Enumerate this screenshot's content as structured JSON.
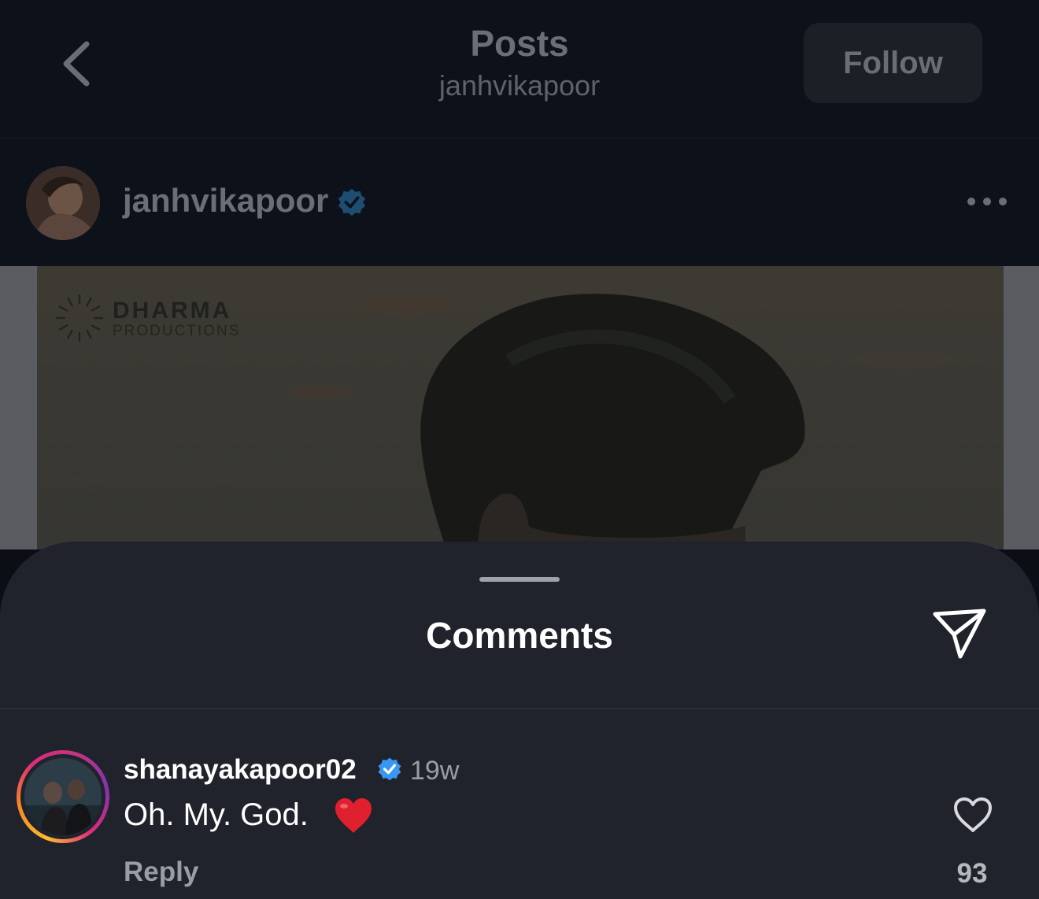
{
  "header": {
    "title": "Posts",
    "subtitle": "janhvikapoor",
    "follow_label": "Follow",
    "back_icon": "chevron-left-icon"
  },
  "post": {
    "username": "janhvikapoor",
    "verified": true,
    "more_icon": "more-horizontal-icon",
    "image": {
      "logo_main": "DHARMA",
      "logo_sub": "PRODUCTIONS"
    }
  },
  "comments_sheet": {
    "title": "Comments",
    "share_icon": "send-icon",
    "comments": [
      {
        "username": "shanayakapoor02",
        "verified": true,
        "time": "19w",
        "text": "Oh. My. God.",
        "emoji": "red-heart-emoji",
        "reply_label": "Reply",
        "like_count": "93",
        "like_icon": "heart-outline-icon"
      }
    ]
  },
  "colors": {
    "background": "#0d111a",
    "sheet": "#20232b",
    "verified_blue": "#3897f0",
    "emoji_red": "#e0202e"
  }
}
